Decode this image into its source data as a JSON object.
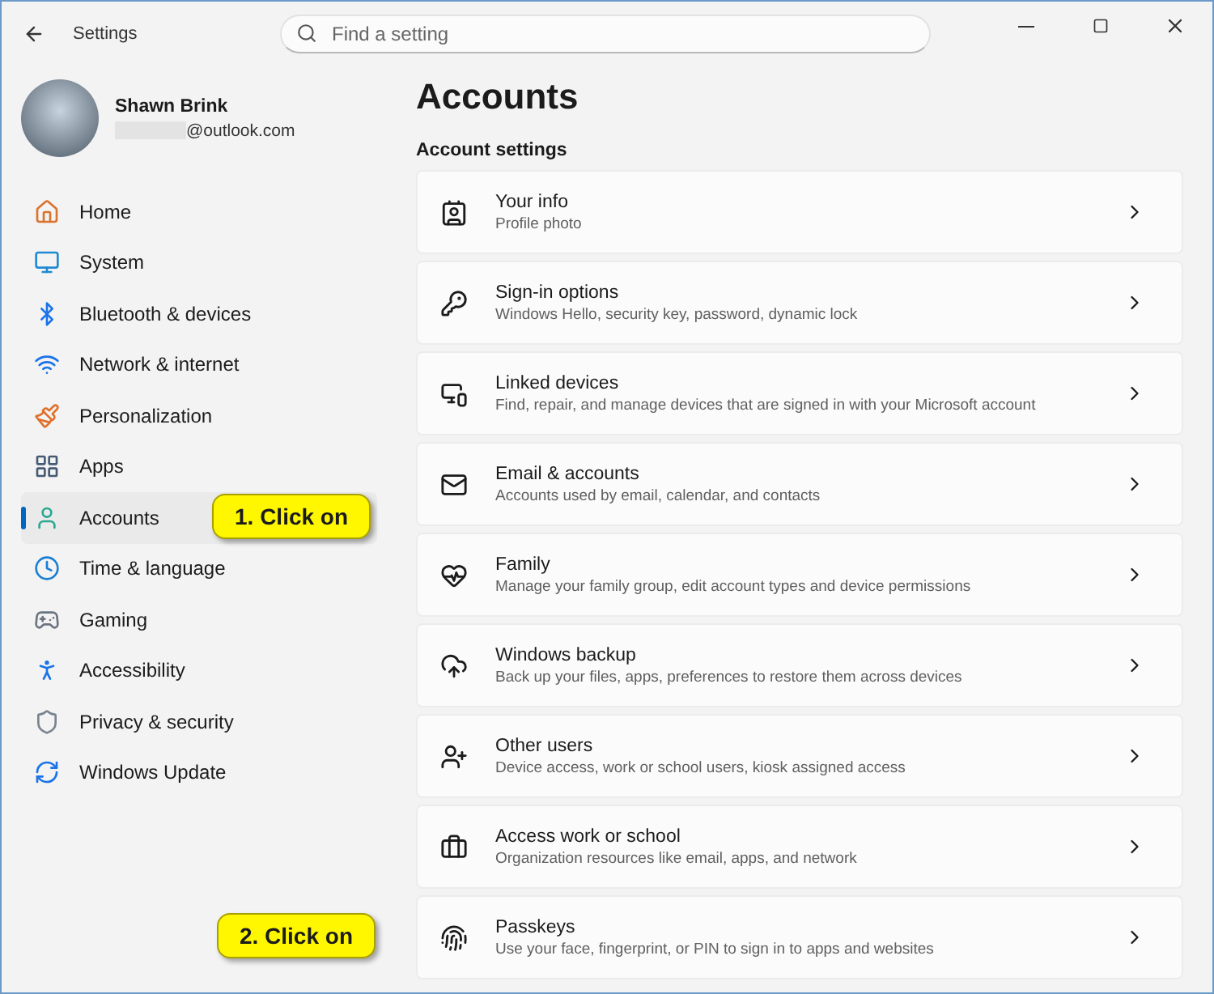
{
  "window": {
    "title": "Settings"
  },
  "search": {
    "placeholder": "Find a setting"
  },
  "user": {
    "name": "Shawn Brink",
    "email": "@outlook.com"
  },
  "nav": [
    {
      "label": "Home",
      "selected": false
    },
    {
      "label": "System",
      "selected": false
    },
    {
      "label": "Bluetooth & devices",
      "selected": false
    },
    {
      "label": "Network & internet",
      "selected": false
    },
    {
      "label": "Personalization",
      "selected": false
    },
    {
      "label": "Apps",
      "selected": false
    },
    {
      "label": "Accounts",
      "selected": true,
      "callout": "1. Click on"
    },
    {
      "label": "Time & language",
      "selected": false
    },
    {
      "label": "Gaming",
      "selected": false
    },
    {
      "label": "Accessibility",
      "selected": false
    },
    {
      "label": "Privacy & security",
      "selected": false
    },
    {
      "label": "Windows Update",
      "selected": false
    }
  ],
  "page_title": "Accounts",
  "section_heading": "Account settings",
  "cards": [
    {
      "title": "Your info",
      "subtitle": "Profile photo"
    },
    {
      "title": "Sign-in options",
      "subtitle": "Windows Hello, security key, password, dynamic lock"
    },
    {
      "title": "Linked devices",
      "subtitle": "Find, repair, and manage devices that are signed in with your Microsoft account"
    },
    {
      "title": "Email & accounts",
      "subtitle": "Accounts used by email, calendar, and contacts"
    },
    {
      "title": "Family",
      "subtitle": "Manage your family group, edit account types and device permissions"
    },
    {
      "title": "Windows backup",
      "subtitle": "Back up your files, apps, preferences to restore them across devices"
    },
    {
      "title": "Other users",
      "subtitle": "Device access, work or school users, kiosk assigned access"
    },
    {
      "title": "Access work or school",
      "subtitle": "Organization resources like email, apps, and network"
    },
    {
      "title": "Passkeys",
      "subtitle": "Use your face, fingerprint, or PIN to sign in to apps and websites",
      "callout": "2. Click on"
    }
  ]
}
